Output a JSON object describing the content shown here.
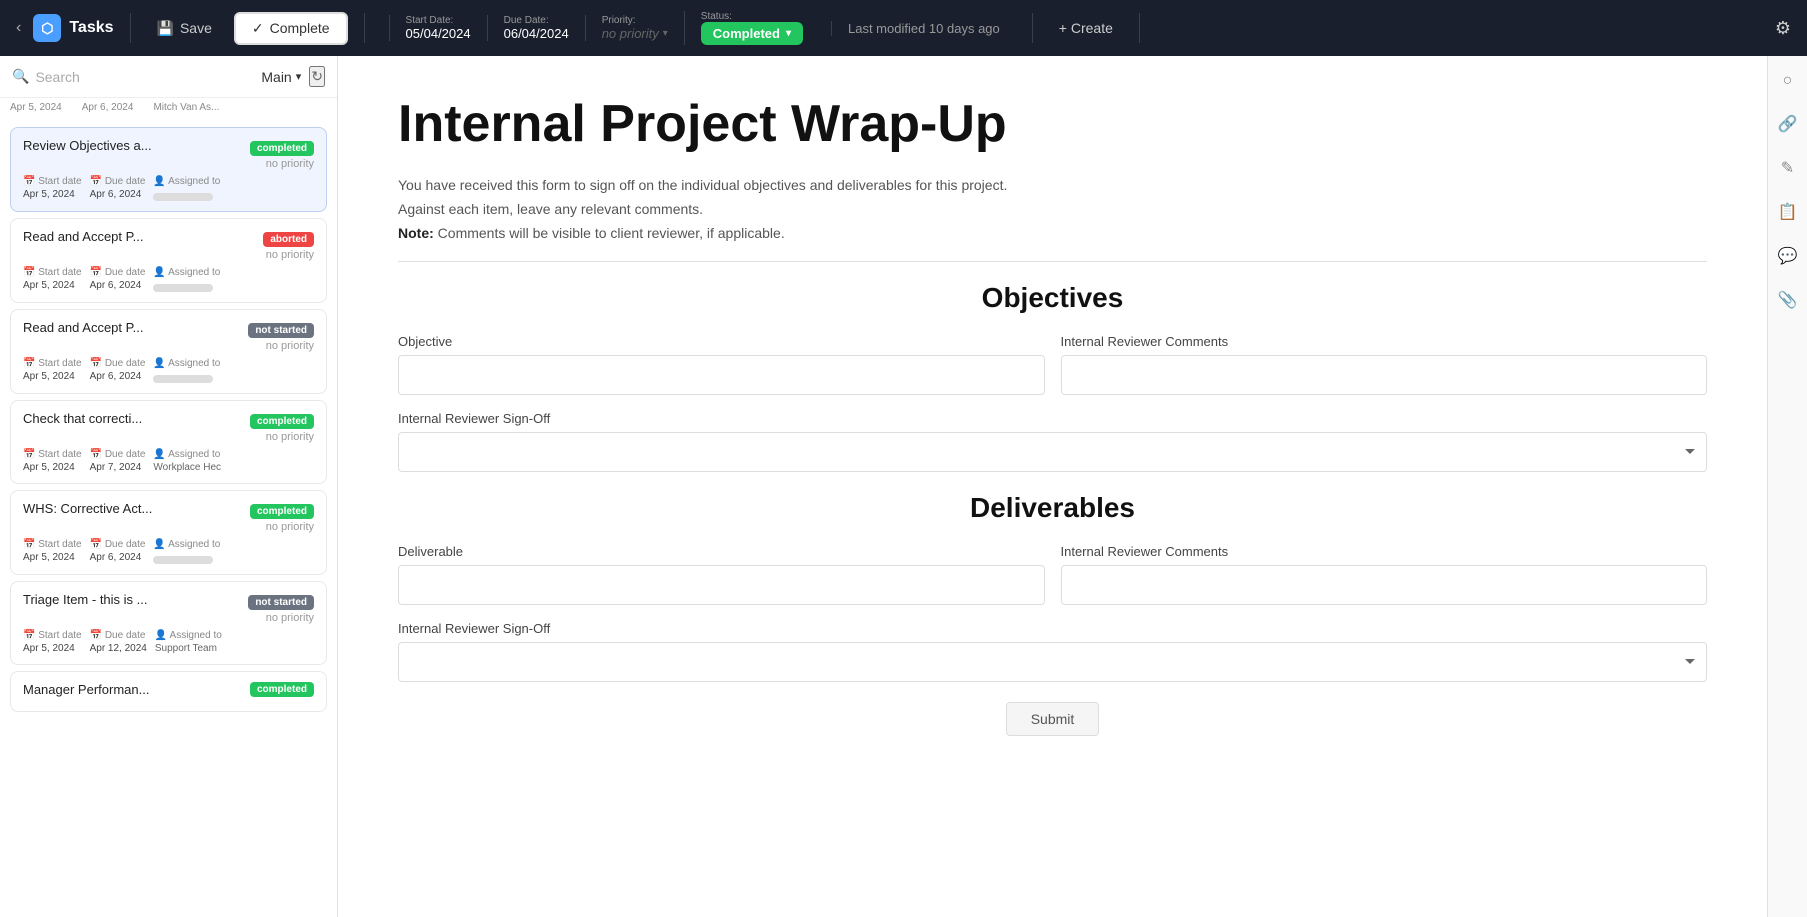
{
  "app": {
    "name": "Tasks",
    "logo_unicode": "⬡"
  },
  "topnav": {
    "save_label": "Save",
    "complete_label": "Complete",
    "check_unicode": "✓",
    "start_date_label": "Start Date:",
    "start_date_value": "05/04/2024",
    "due_date_label": "Due Date:",
    "due_date_value": "06/04/2024",
    "priority_label": "Priority:",
    "priority_value": "no priority",
    "status_label": "Status:",
    "status_value": "Completed",
    "last_modified": "Last modified 10 days ago",
    "create_label": "+ Create",
    "settings_unicode": "⚙"
  },
  "sidebar": {
    "search_placeholder": "Search",
    "view_label": "Main",
    "top_row": [
      "Apr 5, 2024",
      "Apr 6, 2024",
      "Mitch Van As..."
    ],
    "tasks": [
      {
        "title": "Review Objectives a...",
        "status": "completed",
        "badge_class": "badge-completed",
        "priority": "no priority",
        "start_date": "Apr 5, 2024",
        "due_date": "Apr 6, 2024",
        "assigned_label": "Assigned to",
        "assignee": "",
        "active": true
      },
      {
        "title": "Read and Accept P...",
        "status": "aborted",
        "badge_class": "badge-aborted",
        "priority": "no priority",
        "start_date": "Apr 5, 2024",
        "due_date": "Apr 6, 2024",
        "assigned_label": "Assigned to",
        "assignee": "",
        "active": false
      },
      {
        "title": "Read and Accept P...",
        "status": "not started",
        "badge_class": "badge-not-started",
        "priority": "no priority",
        "start_date": "Apr 5, 2024",
        "due_date": "Apr 6, 2024",
        "assigned_label": "Assigned to",
        "assignee": "",
        "active": false
      },
      {
        "title": "Check that correcti...",
        "status": "completed",
        "badge_class": "badge-completed",
        "priority": "no priority",
        "start_date": "Apr 5, 2024",
        "due_date": "Apr 7, 2024",
        "assigned_label": "Assigned to",
        "assignee": "Workplace Hec",
        "active": false
      },
      {
        "title": "WHS: Corrective Act...",
        "status": "completed",
        "badge_class": "badge-completed",
        "priority": "no priority",
        "start_date": "Apr 5, 2024",
        "due_date": "Apr 6, 2024",
        "assigned_label": "Assigned to",
        "assignee": "",
        "active": false
      },
      {
        "title": "Triage Item - this is ...",
        "status": "not started",
        "badge_class": "badge-not-started",
        "priority": "no priority",
        "start_date": "Apr 5, 2024",
        "due_date": "Apr 12, 2024",
        "assigned_label": "Assigned to",
        "assignee": "Support Team",
        "active": false
      },
      {
        "title": "Manager Performan...",
        "status": "completed",
        "badge_class": "badge-completed",
        "priority": "",
        "start_date": "",
        "due_date": "",
        "assigned_label": "",
        "assignee": "",
        "active": false,
        "partial": true
      }
    ]
  },
  "form": {
    "title": "Internal Project Wrap-Up",
    "description": "You have received this form to sign off on the individual objectives and deliverables for this project.",
    "instruction": "Against each item, leave any relevant comments.",
    "note_label": "Note:",
    "note_text": "Comments will be visible to client reviewer, if applicable.",
    "objectives_section": "Objectives",
    "objective_label": "Objective",
    "internal_reviewer_comments_label": "Internal Reviewer Comments",
    "internal_reviewer_signoff_label": "Internal Reviewer Sign-Off",
    "deliverables_section": "Deliverables",
    "deliverable_label": "Deliverable",
    "deliverable_reviewer_comments_label": "Internal Reviewer Comments",
    "deliverable_reviewer_signoff_label": "Internal Reviewer Sign-Off",
    "submit_label": "Submit"
  },
  "right_panel": {
    "icons": [
      "circle-icon",
      "link-icon",
      "edit-icon",
      "copy-icon",
      "chat-icon",
      "attachment-icon"
    ]
  }
}
